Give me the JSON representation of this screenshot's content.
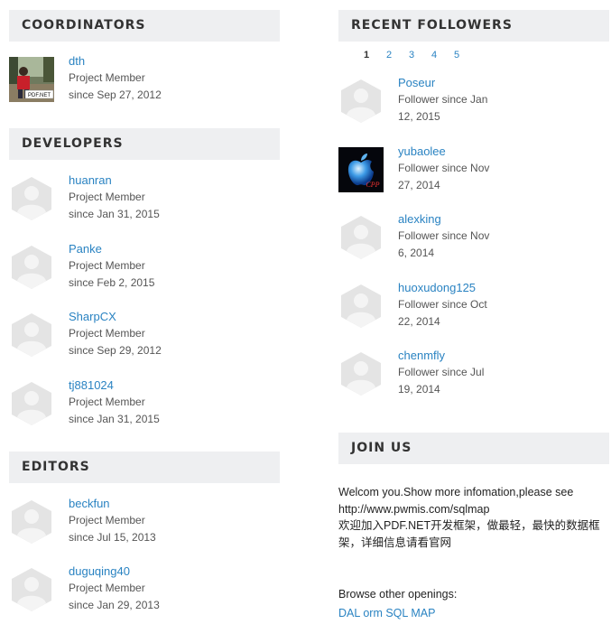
{
  "coordinators": {
    "title": "COORDINATORS",
    "members": [
      {
        "name": "dth",
        "role": "Project Member",
        "since": "since Sep 27, 2012",
        "avatar": "photo",
        "badge": "PDF.NET"
      }
    ]
  },
  "developers": {
    "title": "DEVELOPERS",
    "members": [
      {
        "name": "huanran",
        "role": "Project Member",
        "since": "since Jan 31, 2015",
        "avatar": "default"
      },
      {
        "name": "Panke",
        "role": "Project Member",
        "since": "since Feb 2, 2015",
        "avatar": "default"
      },
      {
        "name": "SharpCX",
        "role": "Project Member",
        "since": "since Sep 29, 2012",
        "avatar": "default"
      },
      {
        "name": "tj881024",
        "role": "Project Member",
        "since": "since Jan 31, 2015",
        "avatar": "default"
      }
    ]
  },
  "editors": {
    "title": "EDITORS",
    "members": [
      {
        "name": "beckfun",
        "role": "Project Member",
        "since": "since Jul 15, 2013",
        "avatar": "default"
      },
      {
        "name": "duguqing40",
        "role": "Project Member",
        "since": "since Jan 29, 2013",
        "avatar": "default"
      }
    ]
  },
  "followers": {
    "title": "RECENT FOLLOWERS",
    "pages": [
      "1",
      "2",
      "3",
      "4",
      "5"
    ],
    "active_page": "1",
    "members": [
      {
        "name": "Poseur",
        "line1": "Follower since Jan",
        "line2": "12, 2015",
        "avatar": "default"
      },
      {
        "name": "yubaolee",
        "line1": "Follower since Nov",
        "line2": "27, 2014",
        "avatar": "apple",
        "badge": "CPP"
      },
      {
        "name": "alexking",
        "line1": "Follower since Nov",
        "line2": "6, 2014",
        "avatar": "default"
      },
      {
        "name": "huoxudong125",
        "line1": "Follower since Oct",
        "line2": "22, 2014",
        "avatar": "default"
      },
      {
        "name": "chenmfly",
        "line1": "Follower since Jul",
        "line2": "19, 2014",
        "avatar": "default"
      }
    ]
  },
  "join": {
    "title": "JOIN US",
    "text1": "Welcom you.Show more infomation,please see",
    "text2": "http://www.pwmis.com/sqlmap",
    "text3": "欢迎加入PDF.NET开发框架，做最轻，最快的数据框",
    "text4": "架，详细信息请看官网",
    "browse_label": "Browse other openings:",
    "link_label": "DAL orm SQL MAP"
  },
  "colors": {
    "link": "#2a83c2",
    "header_bg": "#eeeff1"
  }
}
